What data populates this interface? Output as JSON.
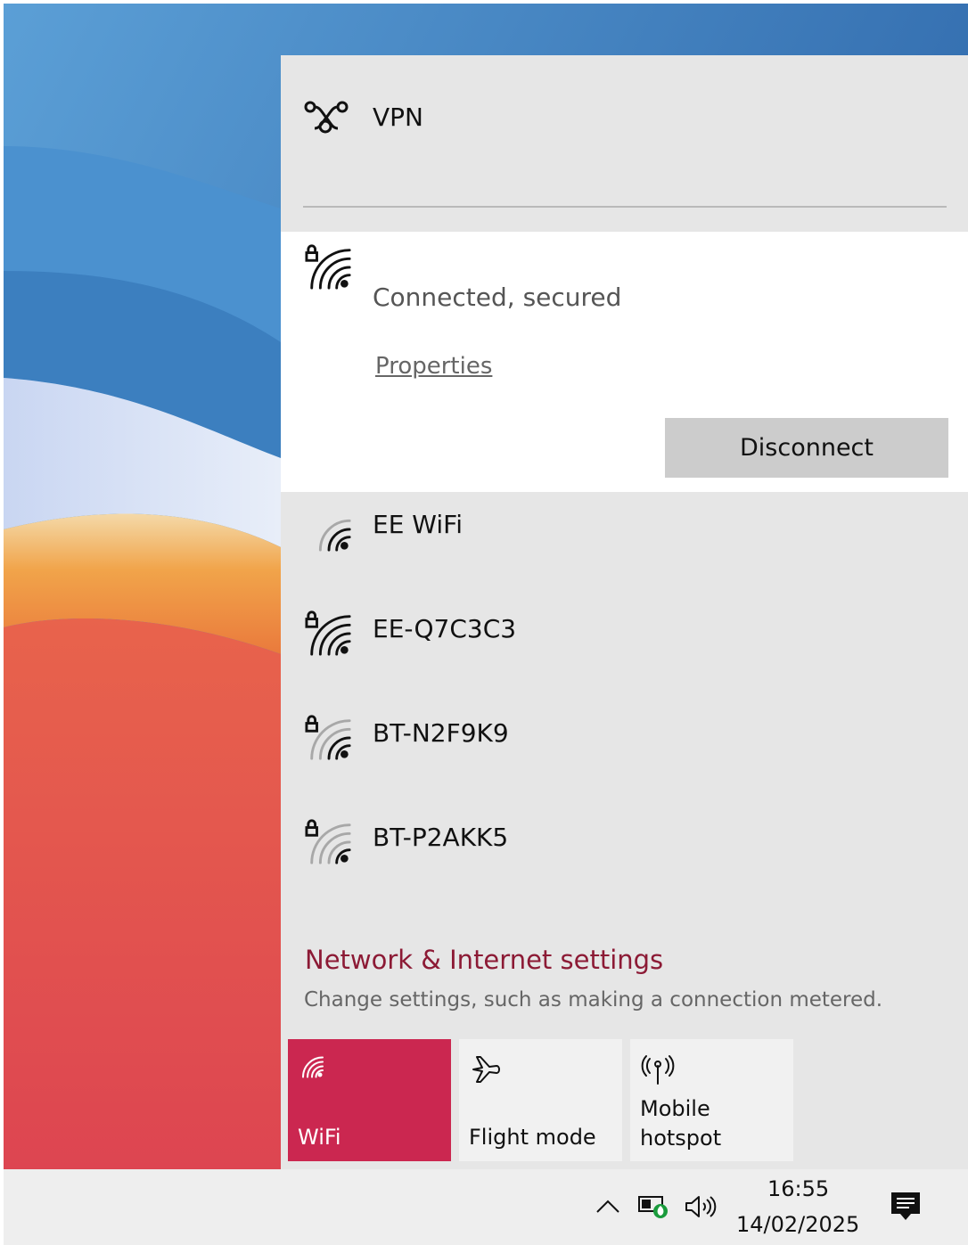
{
  "vpn": {
    "label": "VPN",
    "icon": "vpn-icon"
  },
  "connected_network": {
    "status": "Connected, secured",
    "properties_label": "Properties",
    "disconnect_label": "Disconnect",
    "icon": "wifi-secured-icon"
  },
  "networks": [
    {
      "name": "EE WiFi",
      "secured": false,
      "icon": "wifi-icon"
    },
    {
      "name": "EE-Q7C3C3",
      "secured": true,
      "icon": "wifi-secured-icon"
    },
    {
      "name": "BT-N2F9K9",
      "secured": true,
      "icon": "wifi-secured-icon"
    },
    {
      "name": "BT-P2AKK5",
      "secured": true,
      "icon": "wifi-secured-icon"
    }
  ],
  "settings": {
    "title": "Network & Internet settings",
    "subtitle": "Change settings, such as making a connection metered."
  },
  "quick_actions": [
    {
      "label": "WiFi",
      "active": true,
      "icon": "wifi-icon"
    },
    {
      "label": "Flight mode",
      "active": false,
      "icon": "airplane-icon"
    },
    {
      "label_line1": "Mobile",
      "label_line2": "hotspot",
      "active": false,
      "icon": "mobile-hotspot-icon"
    }
  ],
  "taskbar": {
    "time": "16:55",
    "date": "14/02/2025",
    "icons": [
      "chevron-up-icon",
      "battery-icon",
      "speaker-icon",
      "notification-icon"
    ]
  },
  "colors": {
    "accent": "#cb2750",
    "settings_link": "#8c1a35",
    "flyout_bg": "#e6e6e6"
  }
}
